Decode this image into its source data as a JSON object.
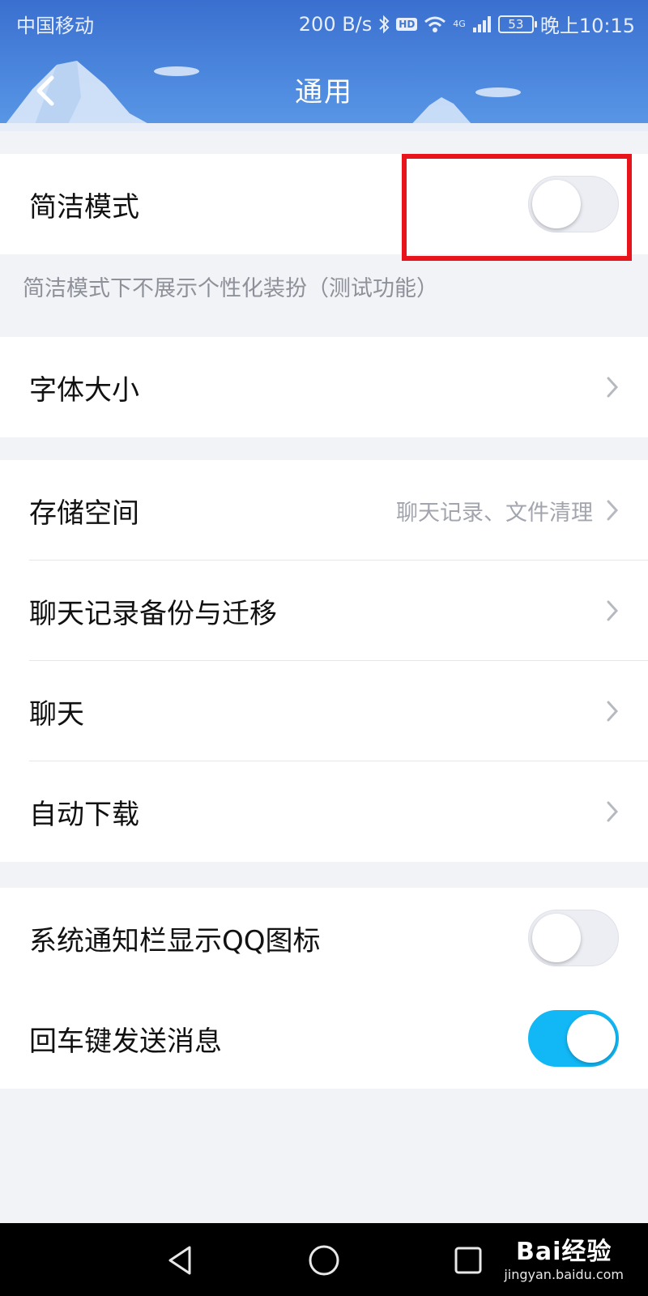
{
  "status_bar": {
    "carrier": "中国移动",
    "speed": "200 B/s",
    "hd": "HD",
    "network": "4G",
    "battery": "53",
    "time": "晚上10:15"
  },
  "header": {
    "title": "通用",
    "back_icon": "back-arrow-icon"
  },
  "simple_mode": {
    "label": "简洁模式",
    "enabled": false,
    "description": "简洁模式下不展示个性化装扮（测试功能）"
  },
  "font_size": {
    "label": "字体大小"
  },
  "storage_group": [
    {
      "label": "存储空间",
      "hint": "聊天记录、文件清理"
    },
    {
      "label": "聊天记录备份与迁移",
      "hint": ""
    },
    {
      "label": "聊天",
      "hint": ""
    },
    {
      "label": "自动下载",
      "hint": ""
    }
  ],
  "toggles_group": [
    {
      "label": "系统通知栏显示QQ图标",
      "enabled": false
    },
    {
      "label": "回车键发送消息",
      "enabled": true
    }
  ],
  "nav": {
    "back_icon": "triangle-back-icon",
    "home_icon": "circle-home-icon",
    "recent_icon": "square-recents-icon"
  },
  "watermark": {
    "main": "Bai经验",
    "sub": "jingyan.baidu.com"
  },
  "colors": {
    "header": "#4b86dd",
    "accent": "#12b7f5",
    "highlight": "#e8141c",
    "background": "#f2f3f7"
  }
}
